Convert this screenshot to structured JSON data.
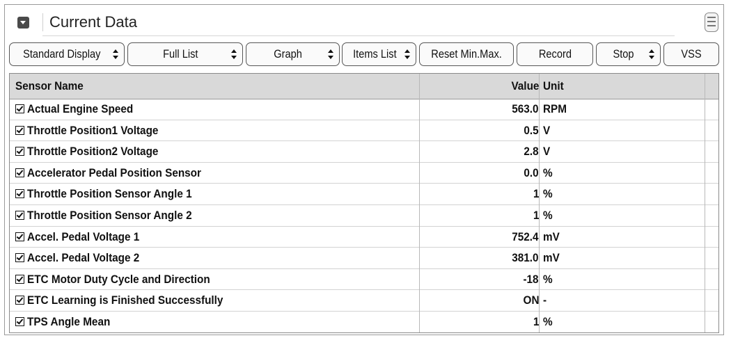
{
  "panel": {
    "title": "Current Data"
  },
  "toolbar": {
    "standard_display": "Standard Display",
    "full_list": "Full List",
    "graph": "Graph",
    "items_list": "Items List",
    "reset_min_max": "Reset Min.Max.",
    "record": "Record",
    "stop": "Stop",
    "vss": "VSS"
  },
  "table": {
    "headers": {
      "sensor_name": "Sensor Name",
      "value": "Value",
      "unit": "Unit"
    },
    "rows": [
      {
        "name": "Actual Engine Speed",
        "value": "563.0",
        "unit": "RPM",
        "checked": true
      },
      {
        "name": "Throttle Position1 Voltage",
        "value": "0.5",
        "unit": "V",
        "checked": true
      },
      {
        "name": "Throttle Position2 Voltage",
        "value": "2.8",
        "unit": "V",
        "checked": true
      },
      {
        "name": "Accelerator Pedal Position Sensor",
        "value": "0.0",
        "unit": "%",
        "checked": true
      },
      {
        "name": "Throttle Position Sensor Angle 1",
        "value": "1",
        "unit": "%",
        "checked": true
      },
      {
        "name": "Throttle Position Sensor Angle 2",
        "value": "1",
        "unit": "%",
        "checked": true
      },
      {
        "name": "Accel. Pedal Voltage 1",
        "value": "752.4",
        "unit": "mV",
        "checked": true
      },
      {
        "name": "Accel. Pedal Voltage 2",
        "value": "381.0",
        "unit": "mV",
        "checked": true
      },
      {
        "name": "ETC Motor Duty Cycle and Direction",
        "value": "-18",
        "unit": "%",
        "checked": true
      },
      {
        "name": "ETC Learning is Finished Successfully",
        "value": "ON",
        "unit": "-",
        "checked": true
      },
      {
        "name": "TPS Angle Mean",
        "value": "1",
        "unit": "%",
        "checked": true
      }
    ]
  }
}
